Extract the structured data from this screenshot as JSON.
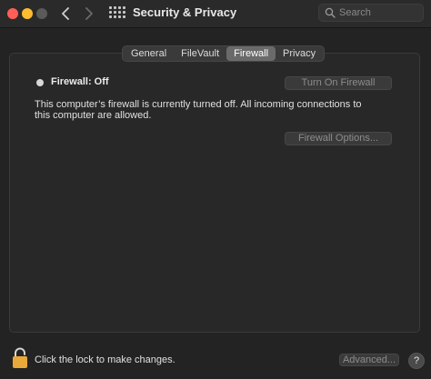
{
  "window": {
    "title": "Security & Privacy"
  },
  "search": {
    "placeholder": "Search"
  },
  "tabs": [
    {
      "label": "General"
    },
    {
      "label": "FileVault"
    },
    {
      "label": "Firewall"
    },
    {
      "label": "Privacy"
    }
  ],
  "firewall": {
    "status": "Firewall: Off",
    "turn_on_label": "Turn On Firewall",
    "description": "This computer’s firewall is currently turned off. All incoming connections to this computer are allowed.",
    "options_label": "Firewall Options..."
  },
  "footer": {
    "lock_text": "Click the lock to make changes.",
    "advanced_label": "Advanced...",
    "help_label": "?"
  },
  "colors": {
    "close": "#ff5f57",
    "minimize": "#febc2e",
    "lock": "#e8a93a"
  }
}
